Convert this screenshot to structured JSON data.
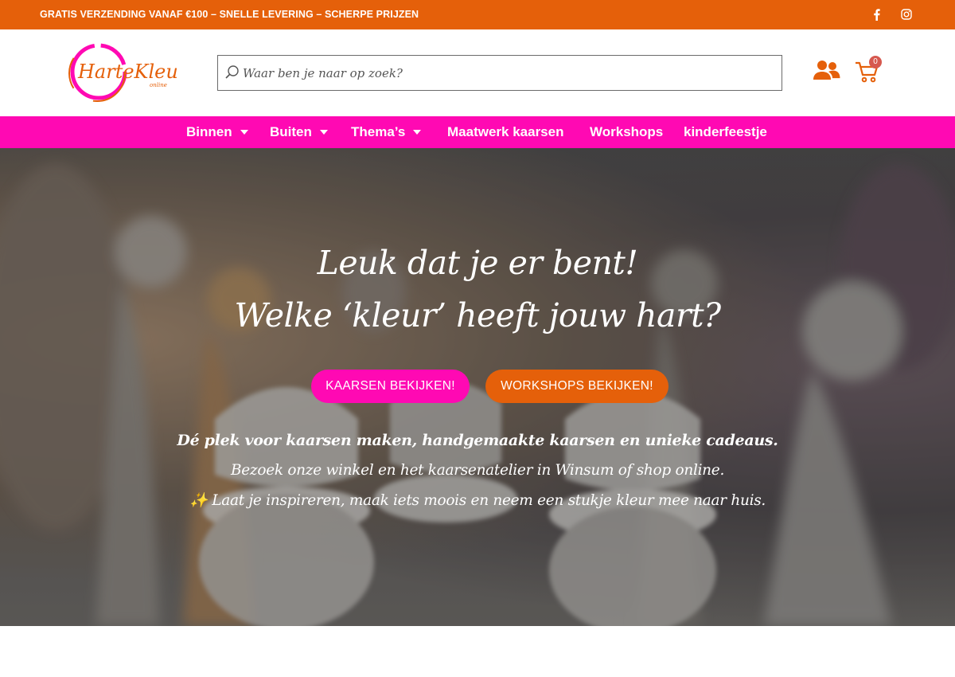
{
  "topbar": {
    "promo_text": "GRATIS VERZENDING VANAF €100 – SNELLE LEVERING – SCHERPE PRIJZEN",
    "social_icons": [
      "facebook-icon",
      "instagram-icon"
    ]
  },
  "header": {
    "logo_text": "HarteKleur",
    "logo_subtext": "online",
    "search": {
      "placeholder": "Waar ben je naar op zoek?",
      "value": ""
    },
    "cart_count": "0"
  },
  "nav": {
    "items": [
      {
        "label": "Binnen",
        "has_dropdown": true
      },
      {
        "label": "Buiten",
        "has_dropdown": true
      },
      {
        "label": "Thema’s",
        "has_dropdown": true
      },
      {
        "label": "Maatwerk kaarsen",
        "has_dropdown": false
      },
      {
        "label": "Workshops",
        "has_dropdown": false
      },
      {
        "label": "kinderfeestje",
        "has_dropdown": false
      }
    ]
  },
  "hero": {
    "title_line1": "Leuk dat je er bent!",
    "title_line2": "Welke ‘kleur’ heeft jouw hart?",
    "btn_candles": "KAARSEN BEKIJKEN!",
    "btn_workshops": "WORKSHOPS BEKIJKEN!",
    "text_line1": "Dé plek voor kaarsen maken, handgemaakte kaarsen en unieke cadeaus.",
    "text_line2": "Bezoek onze winkel en het kaarsenatelier in Winsum of shop online.",
    "text_line3": "✨ Laat je inspireren, maak iets moois en neem een stukje kleur mee naar huis."
  },
  "colors": {
    "orange": "#e5600a",
    "pink": "#ff09b3",
    "badge": "#d6584f"
  }
}
